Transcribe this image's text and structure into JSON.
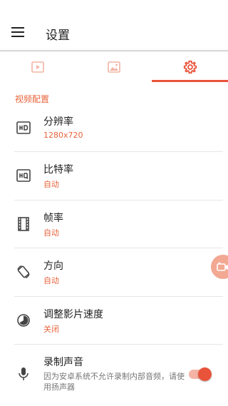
{
  "appbar": {
    "title": "设置"
  },
  "tabs": [
    {
      "icon": "video-icon",
      "selected": false
    },
    {
      "icon": "image-icon",
      "selected": false
    },
    {
      "icon": "gear-icon",
      "selected": true
    }
  ],
  "section": {
    "title": "视频配置"
  },
  "settings": [
    {
      "icon": "hd-icon",
      "title": "分辨率",
      "value": "1280x720"
    },
    {
      "icon": "hq-icon",
      "title": "比特率",
      "value": "自动"
    },
    {
      "icon": "film-icon",
      "title": "帧率",
      "value": "自动"
    },
    {
      "icon": "rotate-icon",
      "title": "方向",
      "value": "自动"
    },
    {
      "icon": "speed-icon",
      "title": "调整影片速度",
      "value": "关闭"
    },
    {
      "icon": "mic-icon",
      "title": "录制声音",
      "value": "因为安卓系统不允许录制内部音频，请使用扬声器",
      "toggle": true
    }
  ],
  "colors": {
    "accent": "#e8533a",
    "accent_text": "#e8633a"
  }
}
